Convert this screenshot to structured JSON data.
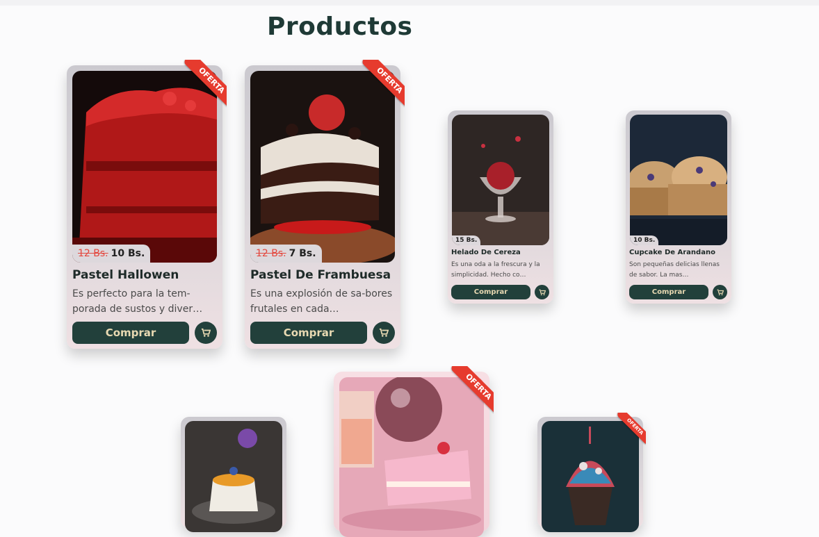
{
  "page": {
    "title": "Productos"
  },
  "offer_label": "OFERTA",
  "buy_label": "Comprar",
  "products": [
    {
      "name": "Pastel Hallowen",
      "old_price": "12 Bs.",
      "price": "10 Bs.",
      "description": "Es perfecto para la tem-porada de sustos y diver…",
      "offer": true
    },
    {
      "name": "Pastel De Frambuesa",
      "old_price": "12 Bs.",
      "price": "7 Bs.",
      "description": "Es una explosión de sa-bores frutales en cada…",
      "offer": true
    },
    {
      "name": "Helado De Cereza",
      "price": "15 Bs.",
      "description": "Es una oda a la frescura y la simplicidad. Hecho co…",
      "offer": false
    },
    {
      "name": "Cupcake De Arandano",
      "price": "10 Bs.",
      "description": "Son pequeñas delicias llenas de sabor. La mas…",
      "offer": false
    },
    {
      "name": "Panna Cotta",
      "offer": false
    },
    {
      "name": "Pastel Rosa",
      "offer": true
    },
    {
      "name": "Cupcake Colorido",
      "offer": true
    }
  ],
  "colors": {
    "primary": "#22403b",
    "accent_text": "#e8d9b2",
    "offer": "#e63b2e",
    "title": "#1f3a36"
  }
}
